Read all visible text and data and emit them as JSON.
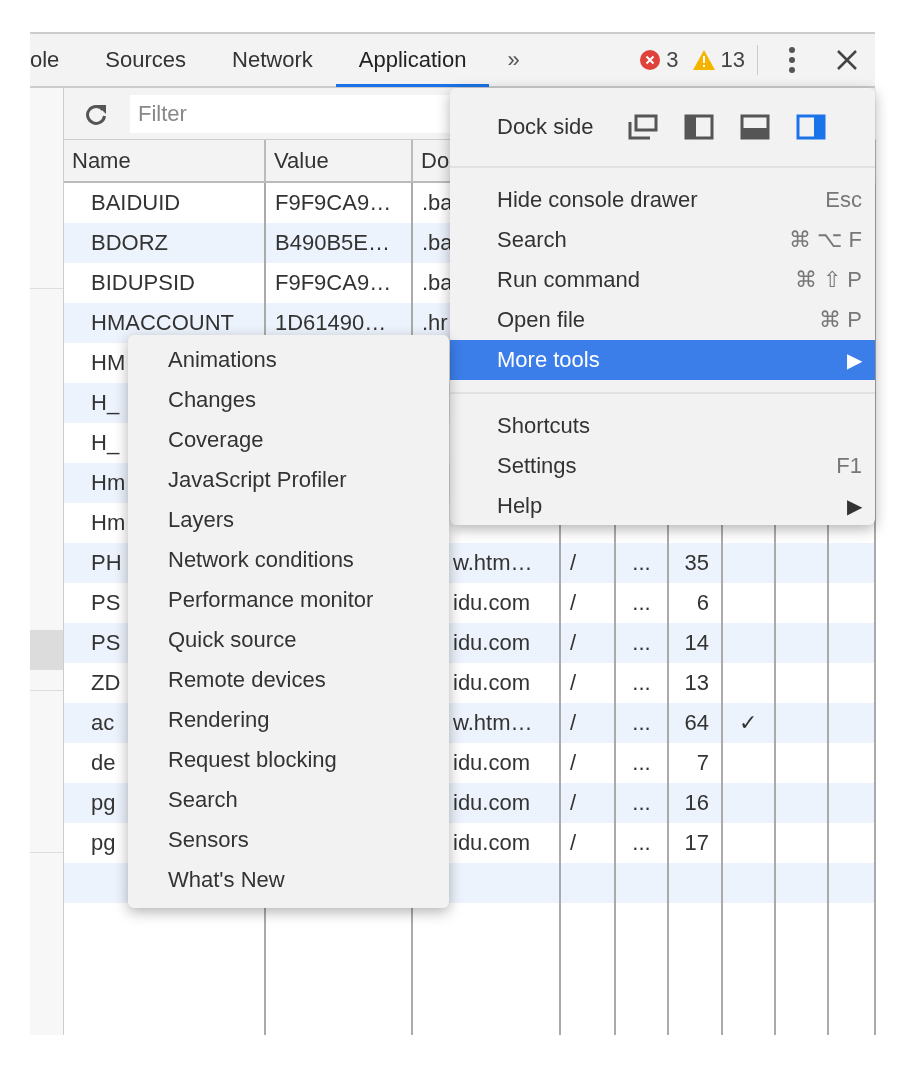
{
  "tabs": [
    {
      "label": "ole",
      "selected": false
    },
    {
      "label": "Sources",
      "selected": false
    },
    {
      "label": "Network",
      "selected": false
    },
    {
      "label": "Application",
      "selected": true
    }
  ],
  "tab_overflow": "»",
  "issues": {
    "errors": "3",
    "warnings": "13"
  },
  "filter": {
    "placeholder": "Filter"
  },
  "table": {
    "columns": [
      "Name",
      "Value",
      "Do"
    ],
    "rows": [
      {
        "name": "BAIDUID",
        "value": "F9F9CA9…",
        "domain": ".ba"
      },
      {
        "name": "BDORZ",
        "value": "B490B5E…",
        "domain": ".ba"
      },
      {
        "name": "BIDUPSID",
        "value": "F9F9CA9…",
        "domain": ".ba"
      },
      {
        "name": "HMACCOUNT",
        "value": "1D61490…",
        "domain": ".hr"
      },
      {
        "name": "HM"
      },
      {
        "name": "H_"
      },
      {
        "name": "H_"
      },
      {
        "name": "Hm"
      },
      {
        "name": "Hm"
      },
      {
        "name": "PH",
        "domain": "w.htm…",
        "path": "/",
        "column_5": "...",
        "size": "35"
      },
      {
        "name": "PS",
        "domain": "idu.com",
        "path": "/",
        "column_5": "...",
        "size": "6"
      },
      {
        "name": "PS",
        "domain": "idu.com",
        "path": "/",
        "column_5": "...",
        "size": "14"
      },
      {
        "name": "ZD",
        "domain": "idu.com",
        "path": "/",
        "column_5": "...",
        "size": "13"
      },
      {
        "name": "ac",
        "domain": "w.htm…",
        "path": "/",
        "column_5": "...",
        "size": "64",
        "column_7": "✓"
      },
      {
        "name": "de",
        "domain": "idu.com",
        "path": "/",
        "column_5": "...",
        "size": "7"
      },
      {
        "name": "pg",
        "domain": "idu.com",
        "path": "/",
        "column_5": "...",
        "size": "16"
      },
      {
        "name": "pg",
        "domain": "idu.com",
        "path": "/",
        "column_5": "...",
        "size": "17"
      }
    ]
  },
  "main_menu": {
    "dock_side": {
      "label": "Dock side",
      "options": [
        {
          "kind": "undock",
          "selected": false
        },
        {
          "kind": "left",
          "selected": false
        },
        {
          "kind": "bottom",
          "selected": false
        },
        {
          "kind": "right",
          "selected": true
        }
      ]
    },
    "sections": [
      {
        "items": [
          {
            "label": "Hide console drawer",
            "shortcut": "Esc",
            "selected": false
          },
          {
            "label": "Search",
            "shortcut": "⌘ ⌥ F",
            "selected": false
          },
          {
            "label": "Run command",
            "shortcut": "⌘ ⇧ P",
            "selected": false
          },
          {
            "label": "Open file",
            "shortcut": "⌘ P",
            "selected": false
          },
          {
            "label": "More tools",
            "arrow": "▶",
            "selected": true
          }
        ]
      },
      {
        "items": [
          {
            "label": "Shortcuts",
            "selected": false
          },
          {
            "label": "Settings",
            "shortcut": "F1",
            "selected": false
          },
          {
            "label": "Help",
            "arrow": "▶",
            "selected": false
          }
        ]
      }
    ]
  },
  "more_tools_menu": {
    "items": [
      "Animations",
      "Changes",
      "Coverage",
      "JavaScript Profiler",
      "Layers",
      "Network conditions",
      "Performance monitor",
      "Quick source",
      "Remote devices",
      "Rendering",
      "Request blocking",
      "Search",
      "Sensors",
      "What's New"
    ]
  }
}
